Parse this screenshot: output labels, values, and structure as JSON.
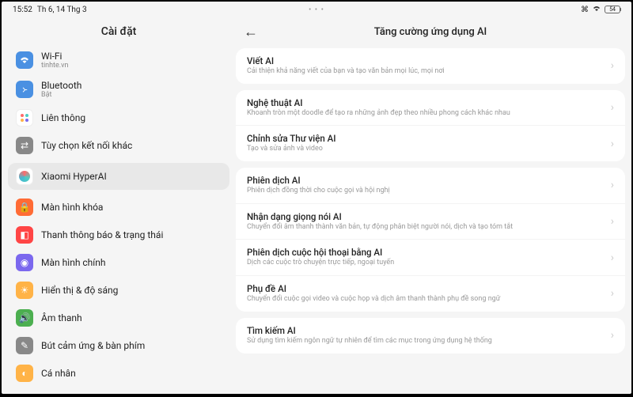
{
  "status": {
    "time": "15:52",
    "date": "Th 6, 14 Thg 3",
    "dots": "• • •",
    "battery": "54"
  },
  "sidebar": {
    "title": "Cài đặt",
    "items": [
      {
        "label": "Wi-Fi",
        "sub": "tinhte.vn"
      },
      {
        "label": "Bluetooth",
        "sub": "Bật"
      },
      {
        "label": "Liên thông"
      },
      {
        "label": "Tùy chọn kết nối khác"
      },
      {
        "label": "Xiaomi HyperAI"
      },
      {
        "label": "Màn hình khóa"
      },
      {
        "label": "Thanh thông báo & trạng thái"
      },
      {
        "label": "Màn hình chính"
      },
      {
        "label": "Hiển thị & độ sáng"
      },
      {
        "label": "Âm thanh"
      },
      {
        "label": "Bút cảm ứng & bàn phím"
      },
      {
        "label": "Cá nhân"
      }
    ]
  },
  "content": {
    "title": "Tăng cường ứng dụng AI",
    "groups": [
      [
        {
          "title": "Viết AI",
          "desc": "Cải thiện khả năng viết của bạn và tạo văn bản mọi lúc, mọi nơi"
        }
      ],
      [
        {
          "title": "Nghệ thuật AI",
          "desc": "Khoanh tròn một doodle để tạo ra những ảnh đẹp theo nhiều phong cách khác nhau"
        },
        {
          "title": "Chỉnh sửa Thư viện AI",
          "desc": "Tạo và sửa ảnh và video"
        }
      ],
      [
        {
          "title": "Phiên dịch AI",
          "desc": "Phiên dịch đồng thời cho cuộc gọi và hội nghị"
        },
        {
          "title": "Nhận dạng giọng nói AI",
          "desc": "Chuyển đổi âm thanh thành văn bản, tự động phân biệt người nói, dịch và tạo tóm tắt"
        },
        {
          "title": "Phiên dịch cuộc hội thoại bằng AI",
          "desc": "Dịch các cuộc trò chuyện trực tiếp, ngoại tuyến"
        },
        {
          "title": "Phụ đề AI",
          "desc": "Chuyển đổi cuộc gọi video và cuộc họp và dịch âm thanh thành phụ đề song ngữ"
        }
      ],
      [
        {
          "title": "Tìm kiếm AI",
          "desc": "Sử dụng tìm kiếm ngôn ngữ tự nhiên để tìm các mục trong ứng dụng hệ thống"
        }
      ]
    ]
  }
}
